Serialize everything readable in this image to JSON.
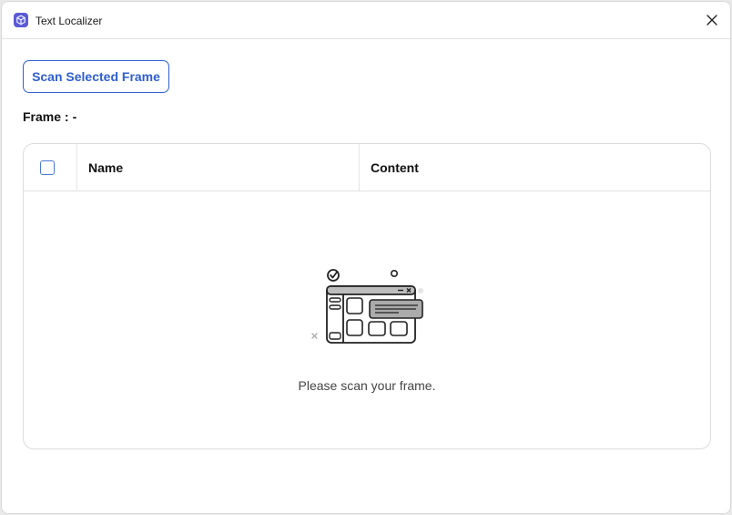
{
  "window": {
    "title": "Text Localizer",
    "app_icon": "cube-icon",
    "close_icon": "close-icon"
  },
  "toolbar": {
    "scan_label": "Scan Selected Frame"
  },
  "frame": {
    "label": "Frame :",
    "value": "-"
  },
  "table": {
    "columns": [
      "Name",
      "Content"
    ],
    "select_all_checked": false,
    "rows": [],
    "empty_message": "Please scan your frame.",
    "empty_illustration": "empty-window-illustration"
  },
  "colors": {
    "accent": "#2f5fd0",
    "app_icon_bg": "#5b5bd6",
    "border": "#dcdcdc"
  }
}
